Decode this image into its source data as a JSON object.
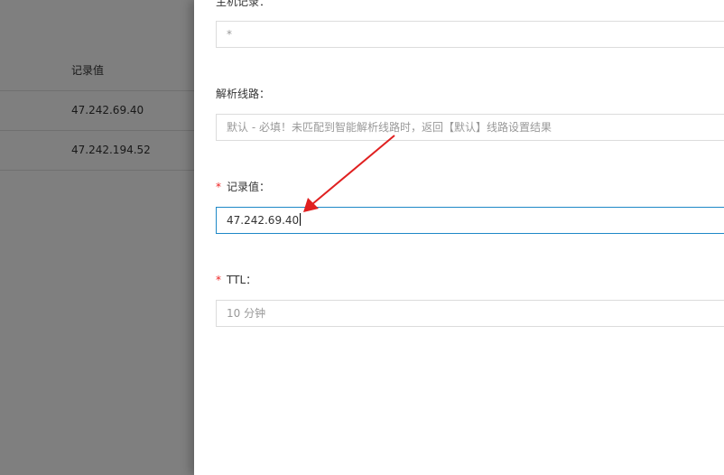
{
  "background_table": {
    "column_header": "记录值",
    "rows": [
      {
        "value": "47.242.69.40"
      },
      {
        "value": "47.242.194.52"
      }
    ]
  },
  "drawer": {
    "host_record": {
      "label": "主机记录：",
      "value": "*"
    },
    "line": {
      "label": "解析线路：",
      "value": "默认 - 必填！未匹配到智能解析线路时，返回【默认】线路设置结果"
    },
    "record_value": {
      "required_mark": "*",
      "label": "记录值：",
      "value": "47.242.69.40"
    },
    "ttl": {
      "required_mark": "*",
      "label": "TTL：",
      "value": "10 分钟"
    }
  },
  "colors": {
    "required": "#e22222",
    "focus_border": "#1e88c7",
    "annotation_arrow": "#e02020"
  }
}
